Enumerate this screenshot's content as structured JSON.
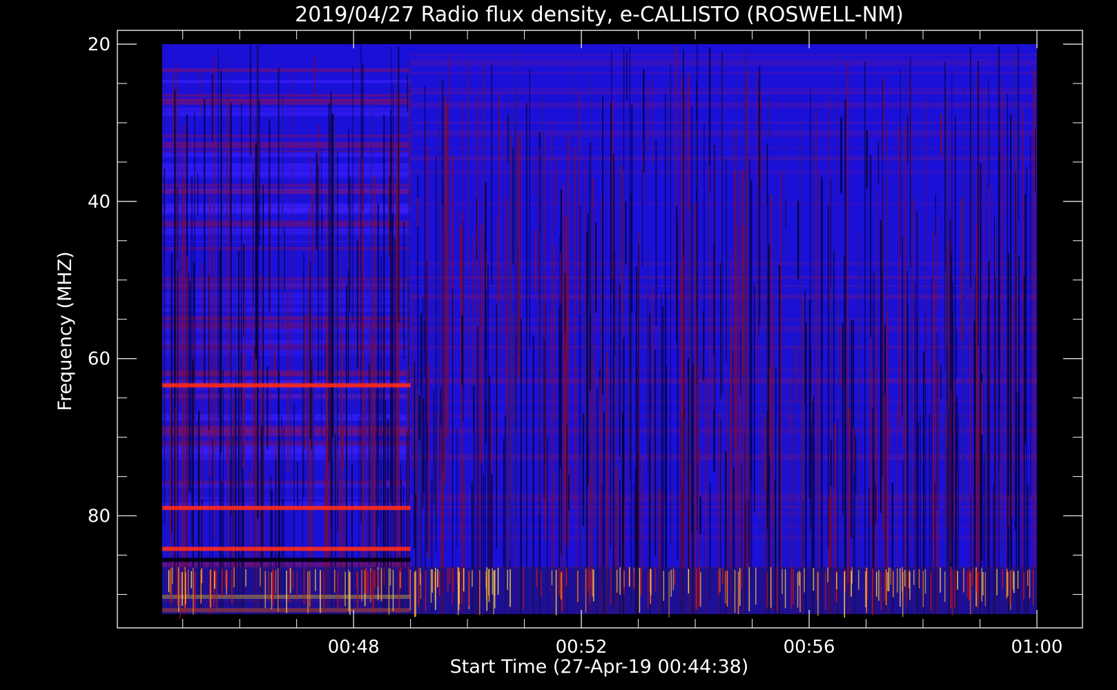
{
  "chart_data": {
    "type": "heatmap",
    "title": "2019/04/27  Radio flux density, e-CALLISTO (ROSWELL-NM)",
    "xlabel": "Start Time (27-Apr-19 00:44:38)",
    "ylabel": "Frequency (MHZ)",
    "x_ticks": [
      "00:48",
      "00:52",
      "00:56",
      "01:00"
    ],
    "x_tick_minutes": [
      48,
      52,
      56,
      60
    ],
    "x_range_minutes": [
      44.64,
      60.0
    ],
    "y_ticks": [
      "20",
      "40",
      "60",
      "80"
    ],
    "y_tick_values": [
      20,
      40,
      60,
      80
    ],
    "y_range": [
      20,
      92.5
    ],
    "y_axis_inverted": true,
    "colormap": [
      "#000000",
      "#0000ff",
      "#b00000",
      "#ff2000",
      "#ffff40"
    ],
    "instrument_change_minute": 49.0,
    "features": [
      {
        "kind": "band",
        "freq": 63.4,
        "before_minute": 49.0,
        "color": "#ff2a1a"
      },
      {
        "kind": "band",
        "freq": 79.0,
        "before_minute": 49.0,
        "color": "#ff2a1a"
      },
      {
        "kind": "band",
        "freq": 84.2,
        "before_minute": 49.0,
        "color": "#ff2a1a"
      },
      {
        "kind": "band",
        "freq": 90.3,
        "before_minute": 49.0,
        "color": "#ffd040"
      },
      {
        "kind": "band",
        "freq": 92.0,
        "before_minute": 49.0,
        "color": "#ff6020"
      },
      {
        "kind": "noisy_region",
        "freq_from": 86.5,
        "freq_to": 92.5,
        "color": "#ffd040"
      }
    ]
  }
}
